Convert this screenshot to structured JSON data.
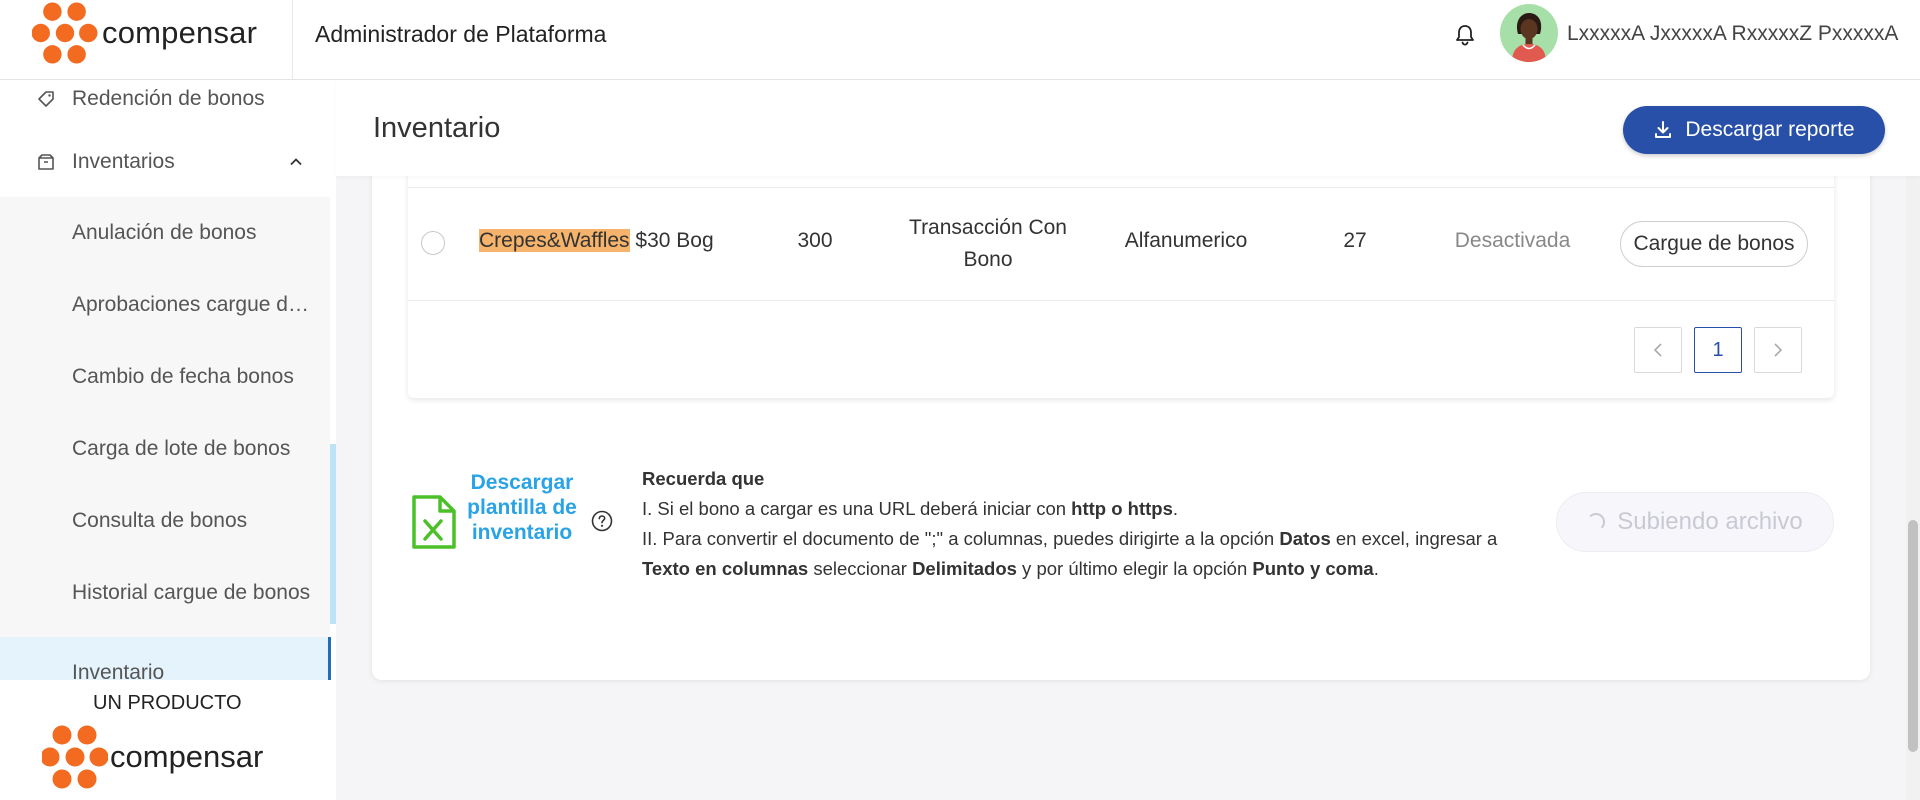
{
  "header": {
    "brand": "compensar",
    "app_title": "Administrador de Plataforma",
    "user_name": "LxxxxxA JxxxxxA RxxxxxZ PxxxxxA"
  },
  "sidebar": {
    "items": [
      {
        "label": "Redención de bonos",
        "icon": "tag-icon"
      },
      {
        "label": "Inventarios",
        "icon": "box-icon",
        "expanded": true
      }
    ],
    "subitems": [
      {
        "label": "Anulación de bonos"
      },
      {
        "label": "Aprobaciones cargue de bonos"
      },
      {
        "label": "Cambio de fecha bonos"
      },
      {
        "label": "Carga de lote de bonos"
      },
      {
        "label": "Consulta de bonos"
      },
      {
        "label": "Historial cargue de bonos"
      },
      {
        "label": "Inventario",
        "active": true
      }
    ],
    "footer_label": "UN PRODUCTO",
    "footer_brand": "compensar"
  },
  "page": {
    "title": "Inventario",
    "download_report_label": "Descargar reporte"
  },
  "table": {
    "row": {
      "name_highlight": "Crepes&Waffles",
      "name_rest": " $30 Bog",
      "quantity": "300",
      "type": "Transacción Con Bono",
      "code_type": "Alfanumerico",
      "count": "27",
      "status": "Desactivada",
      "action_label": "Cargue de bonos"
    },
    "pagination": {
      "prev": "<",
      "current": "1",
      "next": ">"
    }
  },
  "upload": {
    "download_template_label": "Descargar plantilla de inventario",
    "reminder_title": "Recuerda que",
    "line1_prefix": "I. Si el bono a cargar es una URL deberá iniciar con ",
    "line1_bold": "http o https",
    "line1_suffix": ".",
    "line2_part1": "II. Para convertir el documento de \";\" a columnas, puedes dirigirte a la opción ",
    "line2_bold1": "Datos",
    "line2_part2": " en excel, ingresar a ",
    "line2_bold2": "Texto en columnas",
    "line2_part3": " seleccionar ",
    "line2_bold3": "Delimitados",
    "line2_part4": " y por último elegir la opción ",
    "line2_bold4": "Punto y coma",
    "line2_part5": ".",
    "uploading_label": "Subiendo archivo"
  },
  "colors": {
    "brand_orange": "#f26b21",
    "primary_blue": "#2850a8",
    "link_blue": "#29a3e6",
    "highlight": "#f6b36b",
    "excel_green": "#4cc028"
  }
}
